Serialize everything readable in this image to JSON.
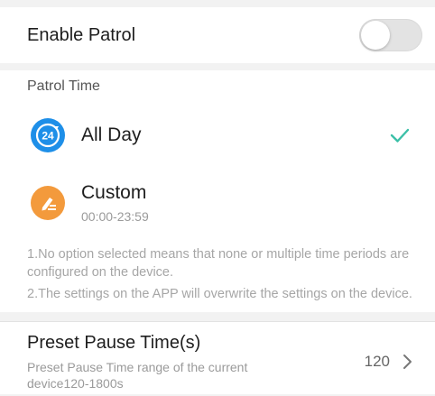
{
  "enable_patrol": {
    "label": "Enable Patrol",
    "enabled": false
  },
  "patrol_time": {
    "heading": "Patrol Time",
    "options": [
      {
        "icon": "clock-24-icon",
        "icon_text": "24",
        "label": "All Day",
        "selected": true
      },
      {
        "icon": "edit-icon",
        "label": "Custom",
        "sub": "00:00-23:59",
        "selected": false
      }
    ],
    "notes": [
      "1.No option selected means that none or multiple time periods are configured on the device.",
      "2.The settings on the APP will overwrite the settings on the device."
    ]
  },
  "preset_pause": {
    "title": "Preset Pause Time(s)",
    "description": "Preset Pause Time range of the current device120-1800s",
    "value": "120"
  },
  "colors": {
    "check": "#3cc0a8",
    "blue_icon": "#1e8fe8",
    "orange_icon": "#f39a3c"
  }
}
